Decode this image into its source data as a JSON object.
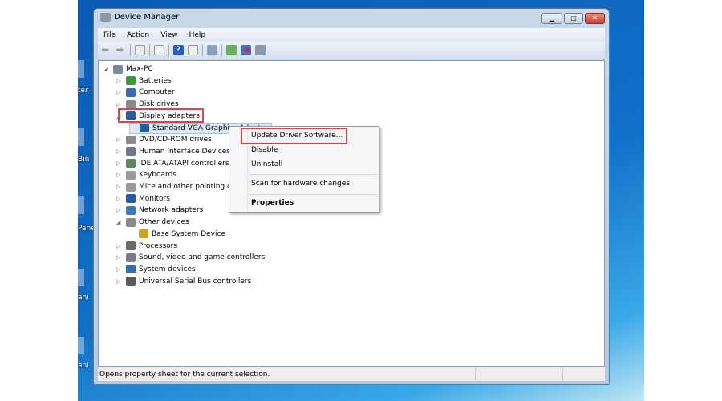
{
  "desktop": {
    "icons": [
      {
        "label": "ter"
      },
      {
        "label": "Bin"
      },
      {
        "label": "Pane"
      },
      {
        "label": "ani"
      },
      {
        "label": "ani"
      }
    ]
  },
  "window": {
    "title": "Device Manager",
    "controls": {
      "minimize": "▁",
      "maximize": "□",
      "close": "✕"
    }
  },
  "menu": [
    "File",
    "Action",
    "View",
    "Help"
  ],
  "toolbar": [
    "back-icon",
    "forward-icon",
    "properties-pane-icon",
    "tree-icon",
    "help-icon",
    "action-pane-icon",
    "scan-icon",
    "update-driver-icon",
    "uninstall-icon",
    "disable-icon"
  ],
  "tree": [
    {
      "label": "Max-PC",
      "level": 0,
      "expander": "◢",
      "icon": "computer-icon",
      "color": "#7a8a9a"
    },
    {
      "label": "Batteries",
      "level": 1,
      "expander": "▷",
      "icon": "battery-icon",
      "color": "#3a9a3a"
    },
    {
      "label": "Computer",
      "level": 1,
      "expander": "▷",
      "icon": "computer-icon",
      "color": "#3a6ab0"
    },
    {
      "label": "Disk drives",
      "level": 1,
      "expander": "▷",
      "icon": "disk-icon",
      "color": "#8a8a8a"
    },
    {
      "label": "Display adapters",
      "level": 1,
      "expander": "◢",
      "icon": "display-icon",
      "color": "#2a5aa0"
    },
    {
      "label": "Standard VGA Graphics Adapter",
      "level": 2,
      "expander": "",
      "icon": "display-icon",
      "color": "#2a5aa0"
    },
    {
      "label": "DVD/CD-ROM drives",
      "level": 1,
      "expander": "▷",
      "icon": "dvd-icon",
      "color": "#8a8a8a"
    },
    {
      "label": "Human Interface Devices",
      "level": 1,
      "expander": "▷",
      "icon": "hid-icon",
      "color": "#6a7a8a"
    },
    {
      "label": "IDE ATA/ATAPI controllers",
      "level": 1,
      "expander": "▷",
      "icon": "ide-icon",
      "color": "#5a8a5a"
    },
    {
      "label": "Keyboards",
      "level": 1,
      "expander": "▷",
      "icon": "keyboard-icon",
      "color": "#9a9a9a"
    },
    {
      "label": "Mice and other pointing devices",
      "level": 1,
      "expander": "▷",
      "icon": "mouse-icon",
      "color": "#9a9a9a"
    },
    {
      "label": "Monitors",
      "level": 1,
      "expander": "▷",
      "icon": "monitor-icon",
      "color": "#2a5aa0"
    },
    {
      "label": "Network adapters",
      "level": 1,
      "expander": "▷",
      "icon": "network-icon",
      "color": "#3a7ac0"
    },
    {
      "label": "Other devices",
      "level": 1,
      "expander": "◢",
      "icon": "other-devices-icon",
      "color": "#8a8a8a"
    },
    {
      "label": "Base System Device",
      "level": 2,
      "expander": "",
      "icon": "warning-device-icon",
      "color": "#d0a020"
    },
    {
      "label": "Processors",
      "level": 1,
      "expander": "▷",
      "icon": "processor-icon",
      "color": "#6a6a6a"
    },
    {
      "label": "Sound, video and game controllers",
      "level": 1,
      "expander": "▷",
      "icon": "sound-icon",
      "color": "#7a7a8a"
    },
    {
      "label": "System devices",
      "level": 1,
      "expander": "▷",
      "icon": "system-icon",
      "color": "#3a6ab0"
    },
    {
      "label": "Universal Serial Bus controllers",
      "level": 1,
      "expander": "▷",
      "icon": "usb-icon",
      "color": "#5a5a5a"
    }
  ],
  "context_menu": {
    "update": "Update Driver Software...",
    "disable": "Disable",
    "uninstall": "Uninstall",
    "scan": "Scan for hardware changes",
    "properties": "Properties"
  },
  "status": "Opens property sheet for the current selection.",
  "colors": {
    "highlight": "#e0404a",
    "selection": "#dce8f6"
  }
}
